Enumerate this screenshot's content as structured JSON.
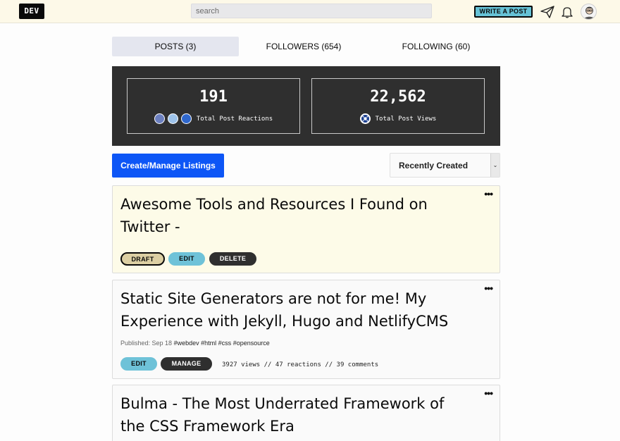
{
  "header": {
    "logo_text": "DEV",
    "search_placeholder": "search",
    "write_post_label": "WRITE A POST"
  },
  "tabs": [
    {
      "label": "POSTS (3)",
      "active": true
    },
    {
      "label": "FOLLOWERS (654)",
      "active": false
    },
    {
      "label": "FOLLOWING (60)",
      "active": false
    }
  ],
  "stats": {
    "reactions_count": "191",
    "reactions_label": "Total Post Reactions",
    "views_count": "22,562",
    "views_label": "Total Post Views"
  },
  "controls": {
    "create_listings_label": "Create/Manage Listings",
    "sort_selected": "Recently Created"
  },
  "posts": [
    {
      "title": "Awesome Tools and Resources I Found on Twitter -",
      "status_label": "DRAFT",
      "edit_label": "EDIT",
      "secondary_label": "DELETE"
    },
    {
      "title": "Static Site Generators are not for me! My Experience with Jekyll, Hugo and NetlifyCMS",
      "published": "Published: Sep 18",
      "tags": [
        "#webdev",
        "#html",
        "#css",
        "#opensource"
      ],
      "edit_label": "EDIT",
      "secondary_label": "MANAGE",
      "stats_text": "3927 views // 47 reactions // 39 comments"
    },
    {
      "title": "Bulma - The Most Underrated Framework of the CSS Framework Era"
    }
  ],
  "colors": {
    "topbar_bg": "#fdf9e8",
    "primary_button": "#0d56f6",
    "write_button": "#66c2d6",
    "stats_panel": "#2f2f2f",
    "draft_card_bg": "#fdfbe8"
  },
  "icons": {
    "post_menu": "more-dots-icon",
    "connect": "paper-plane-icon",
    "notifications": "bell-icon"
  }
}
